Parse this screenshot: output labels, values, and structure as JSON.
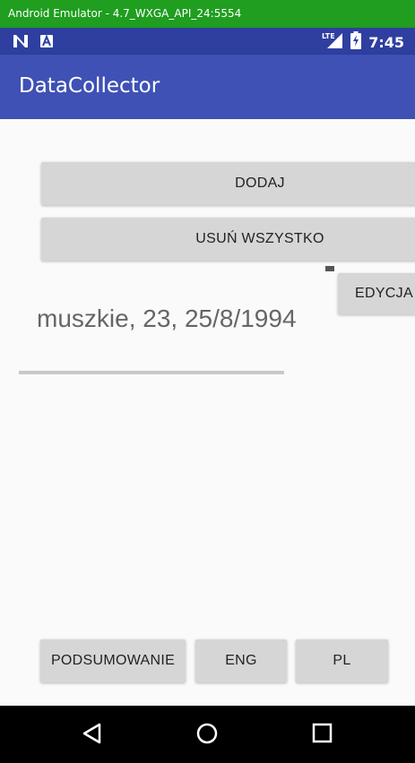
{
  "emulator": {
    "title": "Android Emulator - 4.7_WXGA_API_24:5554"
  },
  "status_bar": {
    "time": "7:45",
    "network": "LTE"
  },
  "app_bar": {
    "title": "DataCollector"
  },
  "buttons": {
    "add": "DODAJ",
    "remove_all": "USUŃ WSZYSTKO",
    "edit": "EDYCJA"
  },
  "list": {
    "items": [
      "muszkie, 23, 25/8/1994"
    ]
  },
  "bottom_buttons": {
    "summary": "PODSUMOWANIE",
    "eng": "ENG",
    "pl": "PL"
  },
  "colors": {
    "emulator_frame": "#1f9e1f",
    "status_bar": "#2f3fa0",
    "app_bar": "#3f51b5",
    "button": "#d6d6d6",
    "nav_bar": "#000000"
  }
}
